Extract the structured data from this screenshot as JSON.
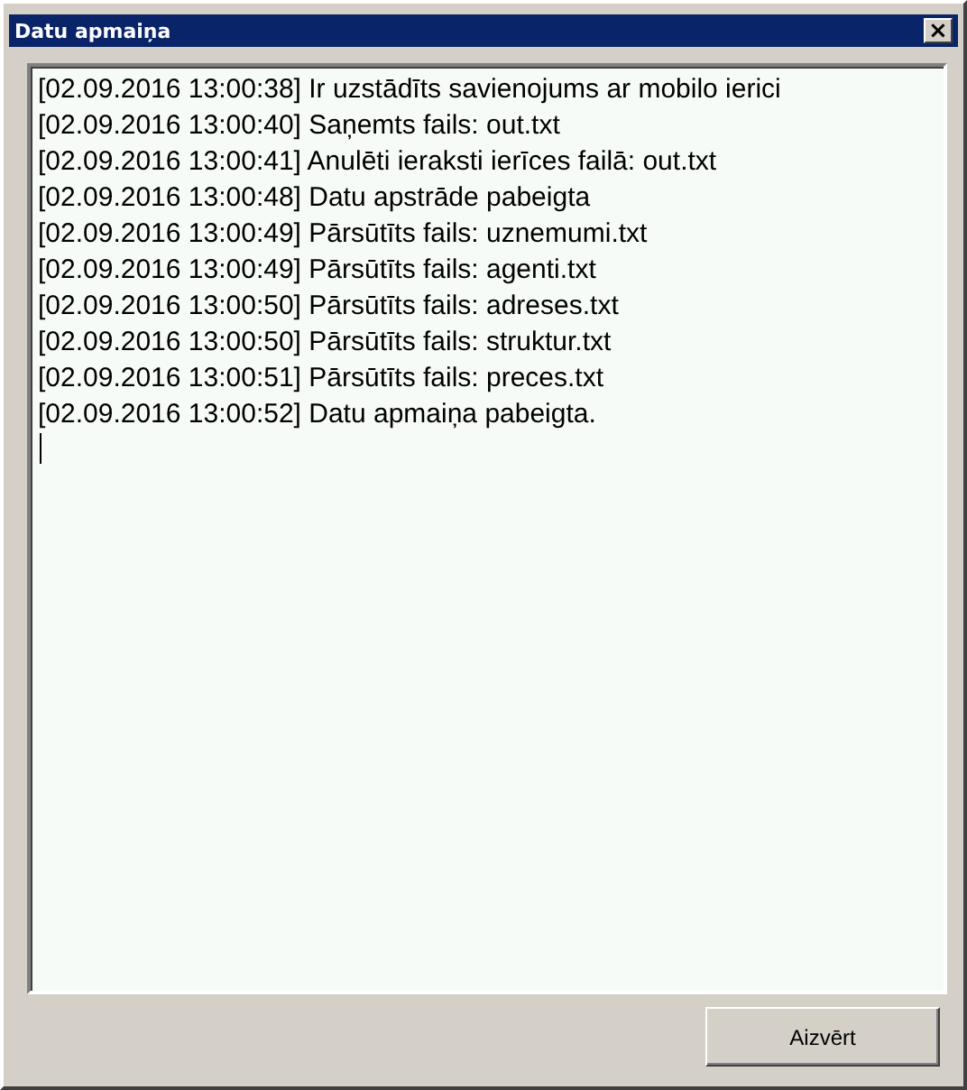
{
  "window": {
    "title": "Datu apmaiņa",
    "close_button": "×"
  },
  "log": {
    "lines": [
      "[02.09.2016 13:00:38] Ir uzstādīts savienojums ar mobilo ierici",
      "[02.09.2016 13:00:40] Saņemts fails: out.txt",
      "[02.09.2016 13:00:41] Anulēti ieraksti ierīces failā: out.txt",
      "[02.09.2016 13:00:48] Datu apstrāde pabeigta",
      "[02.09.2016 13:00:49] Pārsūtīts fails: uznemumi.txt",
      "[02.09.2016 13:00:49] Pārsūtīts fails: agenti.txt",
      "[02.09.2016 13:00:50] Pārsūtīts fails: adreses.txt",
      "[02.09.2016 13:00:50] Pārsūtīts fails: struktur.txt",
      "[02.09.2016 13:00:51] Pārsūtīts fails: preces.txt",
      "[02.09.2016 13:00:52] Datu apmaiņa pabeigta."
    ]
  },
  "buttons": [
    "Aizvērt"
  ]
}
